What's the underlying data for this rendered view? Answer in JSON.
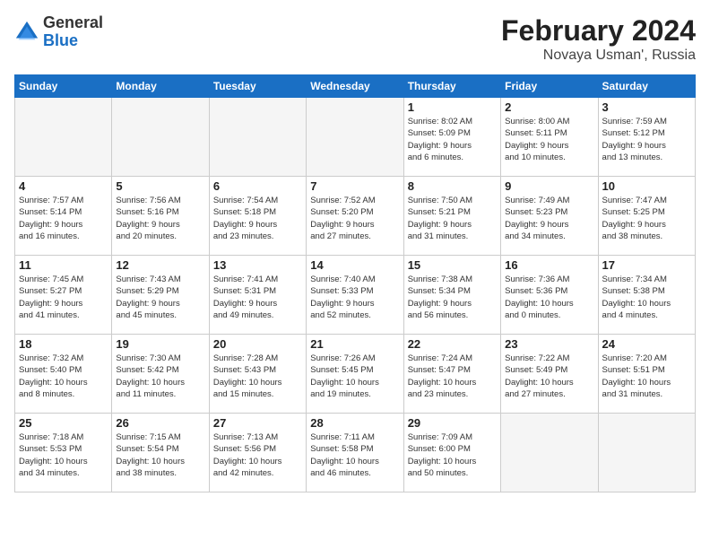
{
  "logo": {
    "general": "General",
    "blue": "Blue"
  },
  "header": {
    "title": "February 2024",
    "subtitle": "Novaya Usman', Russia"
  },
  "weekdays": [
    "Sunday",
    "Monday",
    "Tuesday",
    "Wednesday",
    "Thursday",
    "Friday",
    "Saturday"
  ],
  "weeks": [
    [
      {
        "day": "",
        "info": ""
      },
      {
        "day": "",
        "info": ""
      },
      {
        "day": "",
        "info": ""
      },
      {
        "day": "",
        "info": ""
      },
      {
        "day": "1",
        "info": "Sunrise: 8:02 AM\nSunset: 5:09 PM\nDaylight: 9 hours\nand 6 minutes."
      },
      {
        "day": "2",
        "info": "Sunrise: 8:00 AM\nSunset: 5:11 PM\nDaylight: 9 hours\nand 10 minutes."
      },
      {
        "day": "3",
        "info": "Sunrise: 7:59 AM\nSunset: 5:12 PM\nDaylight: 9 hours\nand 13 minutes."
      }
    ],
    [
      {
        "day": "4",
        "info": "Sunrise: 7:57 AM\nSunset: 5:14 PM\nDaylight: 9 hours\nand 16 minutes."
      },
      {
        "day": "5",
        "info": "Sunrise: 7:56 AM\nSunset: 5:16 PM\nDaylight: 9 hours\nand 20 minutes."
      },
      {
        "day": "6",
        "info": "Sunrise: 7:54 AM\nSunset: 5:18 PM\nDaylight: 9 hours\nand 23 minutes."
      },
      {
        "day": "7",
        "info": "Sunrise: 7:52 AM\nSunset: 5:20 PM\nDaylight: 9 hours\nand 27 minutes."
      },
      {
        "day": "8",
        "info": "Sunrise: 7:50 AM\nSunset: 5:21 PM\nDaylight: 9 hours\nand 31 minutes."
      },
      {
        "day": "9",
        "info": "Sunrise: 7:49 AM\nSunset: 5:23 PM\nDaylight: 9 hours\nand 34 minutes."
      },
      {
        "day": "10",
        "info": "Sunrise: 7:47 AM\nSunset: 5:25 PM\nDaylight: 9 hours\nand 38 minutes."
      }
    ],
    [
      {
        "day": "11",
        "info": "Sunrise: 7:45 AM\nSunset: 5:27 PM\nDaylight: 9 hours\nand 41 minutes."
      },
      {
        "day": "12",
        "info": "Sunrise: 7:43 AM\nSunset: 5:29 PM\nDaylight: 9 hours\nand 45 minutes."
      },
      {
        "day": "13",
        "info": "Sunrise: 7:41 AM\nSunset: 5:31 PM\nDaylight: 9 hours\nand 49 minutes."
      },
      {
        "day": "14",
        "info": "Sunrise: 7:40 AM\nSunset: 5:33 PM\nDaylight: 9 hours\nand 52 minutes."
      },
      {
        "day": "15",
        "info": "Sunrise: 7:38 AM\nSunset: 5:34 PM\nDaylight: 9 hours\nand 56 minutes."
      },
      {
        "day": "16",
        "info": "Sunrise: 7:36 AM\nSunset: 5:36 PM\nDaylight: 10 hours\nand 0 minutes."
      },
      {
        "day": "17",
        "info": "Sunrise: 7:34 AM\nSunset: 5:38 PM\nDaylight: 10 hours\nand 4 minutes."
      }
    ],
    [
      {
        "day": "18",
        "info": "Sunrise: 7:32 AM\nSunset: 5:40 PM\nDaylight: 10 hours\nand 8 minutes."
      },
      {
        "day": "19",
        "info": "Sunrise: 7:30 AM\nSunset: 5:42 PM\nDaylight: 10 hours\nand 11 minutes."
      },
      {
        "day": "20",
        "info": "Sunrise: 7:28 AM\nSunset: 5:43 PM\nDaylight: 10 hours\nand 15 minutes."
      },
      {
        "day": "21",
        "info": "Sunrise: 7:26 AM\nSunset: 5:45 PM\nDaylight: 10 hours\nand 19 minutes."
      },
      {
        "day": "22",
        "info": "Sunrise: 7:24 AM\nSunset: 5:47 PM\nDaylight: 10 hours\nand 23 minutes."
      },
      {
        "day": "23",
        "info": "Sunrise: 7:22 AM\nSunset: 5:49 PM\nDaylight: 10 hours\nand 27 minutes."
      },
      {
        "day": "24",
        "info": "Sunrise: 7:20 AM\nSunset: 5:51 PM\nDaylight: 10 hours\nand 31 minutes."
      }
    ],
    [
      {
        "day": "25",
        "info": "Sunrise: 7:18 AM\nSunset: 5:53 PM\nDaylight: 10 hours\nand 34 minutes."
      },
      {
        "day": "26",
        "info": "Sunrise: 7:15 AM\nSunset: 5:54 PM\nDaylight: 10 hours\nand 38 minutes."
      },
      {
        "day": "27",
        "info": "Sunrise: 7:13 AM\nSunset: 5:56 PM\nDaylight: 10 hours\nand 42 minutes."
      },
      {
        "day": "28",
        "info": "Sunrise: 7:11 AM\nSunset: 5:58 PM\nDaylight: 10 hours\nand 46 minutes."
      },
      {
        "day": "29",
        "info": "Sunrise: 7:09 AM\nSunset: 6:00 PM\nDaylight: 10 hours\nand 50 minutes."
      },
      {
        "day": "",
        "info": ""
      },
      {
        "day": "",
        "info": ""
      }
    ]
  ]
}
